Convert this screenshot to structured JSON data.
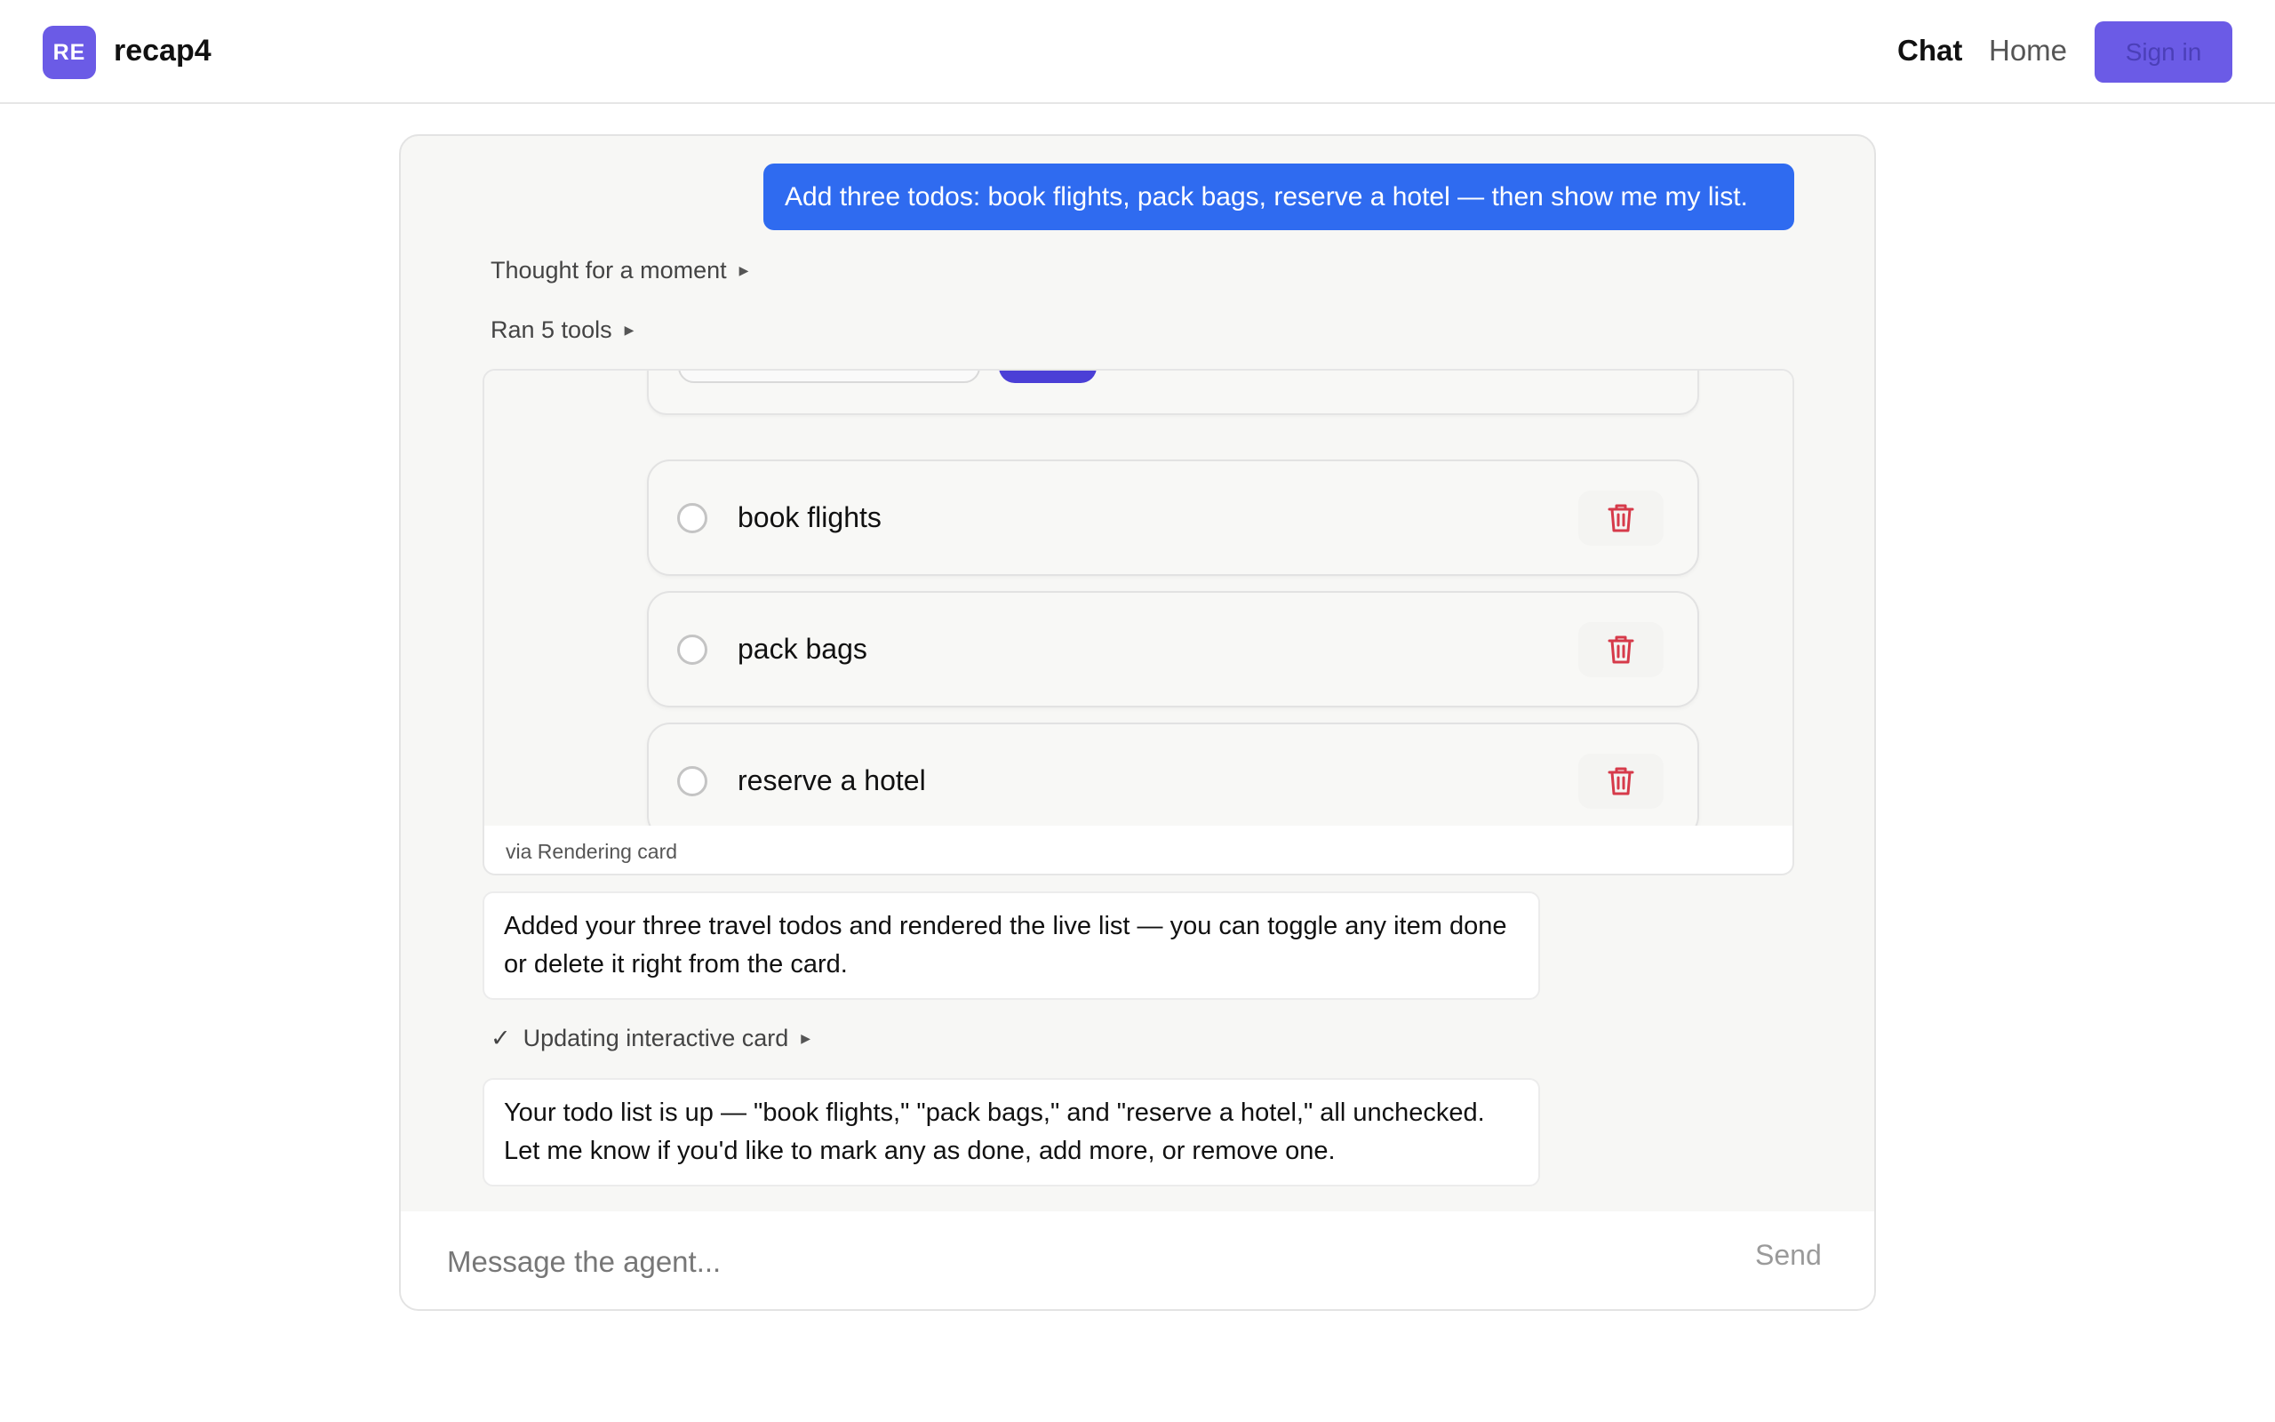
{
  "header": {
    "logo_initials": "RE",
    "brand": "recap4",
    "nav": {
      "chat": "Chat",
      "home": "Home"
    },
    "signin_label": "Sign in",
    "accent_color": "#6b5be6"
  },
  "chat": {
    "user_message": "Add three todos: book flights, pack bags, reserve a hotel — then show me my list.",
    "thought_label": "Thought for a moment",
    "tools_label": "Ran 5 tools",
    "card": {
      "todos": [
        {
          "label": "book flights",
          "done": false,
          "delete_icon": "trash-icon"
        },
        {
          "label": "pack bags",
          "done": false,
          "delete_icon": "trash-icon"
        },
        {
          "label": "reserve a hotel",
          "done": false,
          "delete_icon": "trash-icon"
        }
      ],
      "footer": "via Rendering card"
    },
    "assistant_message_1": "Added your three travel todos and rendered the live list — you can toggle any item done or delete it right from the card.",
    "update_label": "Updating interactive card",
    "assistant_message_2": "Your todo list is up — \"book flights,\" \"pack bags,\" and \"reserve a hotel,\" all unchecked. Let me know if you'd like to mark any as done, add more, or remove one."
  },
  "composer": {
    "placeholder": "Message the agent...",
    "send_label": "Send"
  },
  "colors": {
    "user_bubble": "#2f6bf0",
    "delete_red": "#d63a4a"
  }
}
